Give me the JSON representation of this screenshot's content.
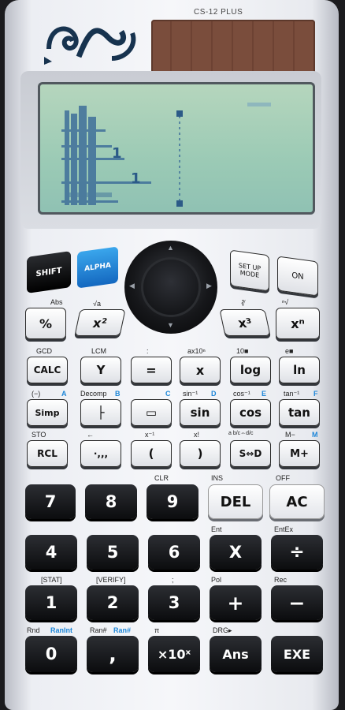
{
  "model_name": "CS-12 PLUS",
  "display": {
    "one_a": "1",
    "one_b": "1"
  },
  "fn_row1": {
    "shift": "SHIFT",
    "alpha": "ALPHA",
    "setup_mode_top": "SET UP",
    "setup_mode_bottom": "MODE",
    "on": "ON",
    "percent": "%",
    "percent_sub": "Abs",
    "x2": "x²",
    "sqrt_sub": "√a",
    "x3": "x³",
    "xn": "xⁿ",
    "x3_sub": "∛",
    "xn_sub": "ⁿ√"
  },
  "fn_row2": {
    "calc": "CALC",
    "calc_sub": "GCD",
    "y": "Y",
    "y_sub": "LCM",
    "eq": "=",
    "eq_sub": ":",
    "x": "x",
    "x_sub": "ax10ⁿ",
    "log": "log",
    "log_sub": "10■",
    "ln": "ln",
    "ln_sub": "e■"
  },
  "fn_row3": {
    "simp": "Simp",
    "simp_sub": "(−)",
    "simp_sub2": "A",
    "frac": "├",
    "frac_sub": "Decomp",
    "frac_sub2": "B",
    "ab": "▭",
    "ab_sub2": "C",
    "sin": "sin",
    "sin_sub": "sin⁻¹",
    "sin_sub2": "D",
    "cos": "cos",
    "cos_sub": "cos⁻¹",
    "cos_sub2": "E",
    "tan": "tan",
    "tan_sub": "tan⁻¹",
    "tan_sub2": "F"
  },
  "fn_row4": {
    "rcl": "RCL",
    "rcl_sub": "STO",
    "deg": "·,,,",
    "deg_sub": "←",
    "lparen": "(",
    "lparen_sub": "x⁻¹",
    "rparen": ")",
    "rparen_sub": "x!",
    "sd": "S⇔D",
    "sd_sub": "a b/c⇔d/c",
    "mplus": "M+",
    "mplus_sub": "M−",
    "mplus_sub2": "M"
  },
  "keys": {
    "k7": "7",
    "k8": "8",
    "k9": "9",
    "del": "DEL",
    "ac": "AC",
    "k4": "4",
    "k5": "5",
    "k6": "6",
    "mul": "X",
    "div": "÷",
    "k1": "1",
    "k2": "2",
    "k3": "3",
    "plus": "+",
    "minus": "−",
    "k0": "0",
    "comma": ",",
    "x10": "×10ˣ",
    "ans": "Ans",
    "exe": "EXE"
  },
  "key_labels": {
    "clr": "CLR",
    "ins": "INS",
    "off": "OFF",
    "ent": "Ent",
    "entex": "EntEx",
    "stat": "[STAT]",
    "verify": "[VERIFY]",
    "semicolon": ";",
    "pol": "Pol",
    "rec": "Rec",
    "rnd": "Rnd",
    "rnd_alt": "RanInt",
    "ran": "Ran#",
    "ran_alt": "Ran#",
    "pi": "π",
    "drg": "DRG▸"
  }
}
